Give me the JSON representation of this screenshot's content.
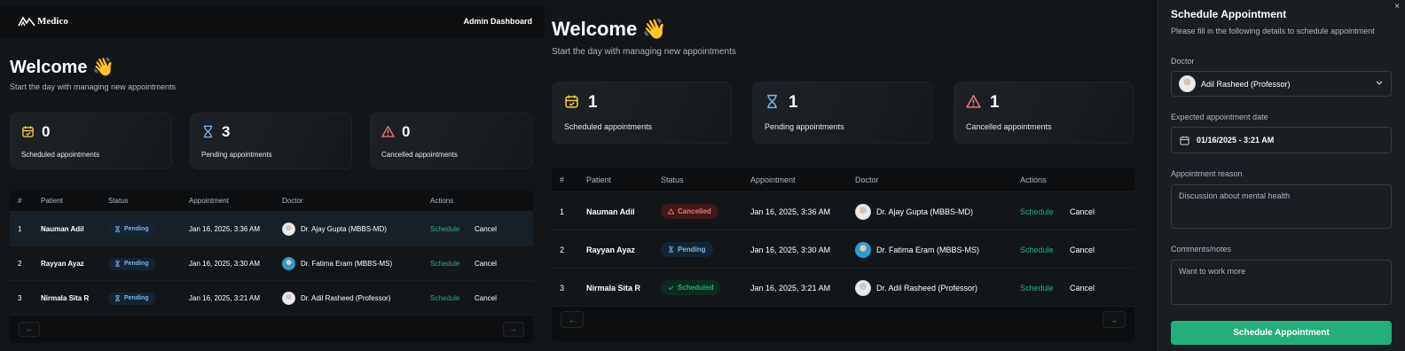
{
  "header": {
    "logo_text": "Medico",
    "title": "Admin Dashboard"
  },
  "welcome": {
    "title": "Welcome",
    "emoji": "👋",
    "subtitle": "Start the day with managing new appointments"
  },
  "icons": {
    "scheduled": "calendar-icon",
    "pending": "hourglass-icon",
    "cancelled": "warning-triangle-icon",
    "next": "arrow-right-icon",
    "prev": "arrow-left-icon",
    "close": "close-icon",
    "dropdown": "chevron-down-icon",
    "date": "calendar-icon"
  },
  "colors": {
    "green": "#24ae7c",
    "yellow": "#ffd147",
    "blue": "#79b5ec",
    "red": "#f37877"
  },
  "columns": [
    "#",
    "Patient",
    "Status",
    "Appointment",
    "Doctor",
    "Actions"
  ],
  "actions": {
    "schedule": "Schedule",
    "cancel": "Cancel"
  },
  "pager": {
    "prev": "←",
    "next": "→"
  },
  "view1": {
    "stats": [
      {
        "count": "0",
        "label": "Scheduled appointments"
      },
      {
        "count": "3",
        "label": "Pending appointments"
      },
      {
        "count": "0",
        "label": "Cancelled appointments"
      }
    ],
    "rows": [
      {
        "num": "1",
        "patient": "Nauman Adil",
        "status": "Pending",
        "date": "Jan 16, 2025, 3:36 AM",
        "doctor": "Dr. Ajay Gupta (MBBS-MD)"
      },
      {
        "num": "2",
        "patient": "Rayyan Ayaz",
        "status": "Pending",
        "date": "Jan 16, 2025, 3:30 AM",
        "doctor": "Dr. Fatima Eram (MBBS-MS)"
      },
      {
        "num": "3",
        "patient": "Nirmala Sita R",
        "status": "Pending",
        "date": "Jan 16, 2025, 3:21 AM",
        "doctor": "Dr. Adil Rasheed (Professor)"
      }
    ]
  },
  "view2": {
    "stats": [
      {
        "count": "1",
        "label": "Scheduled appointments"
      },
      {
        "count": "1",
        "label": "Pending appointments"
      },
      {
        "count": "1",
        "label": "Cancelled appointments"
      }
    ],
    "rows": [
      {
        "num": "1",
        "patient": "Nauman Adil",
        "status": "Cancelled",
        "date": "Jan 16, 2025, 3:36 AM",
        "doctor": "Dr. Ajay Gupta (MBBS-MD)"
      },
      {
        "num": "2",
        "patient": "Rayyan Ayaz",
        "status": "Pending",
        "date": "Jan 16, 2025, 3:30 AM",
        "doctor": "Dr. Fatima Eram (MBBS-MS)"
      },
      {
        "num": "3",
        "patient": "Nirmala Sita R",
        "status": "Scheduled",
        "date": "Jan 16, 2025, 3:21 AM",
        "doctor": "Dr. Adil Rasheed (Professor)"
      }
    ]
  },
  "form": {
    "close": "×",
    "title": "Schedule Appointment",
    "subtitle": "Please fill in the following details to schedule appointment",
    "doctor_label": "Doctor",
    "doctor_value": "Adil Rasheed (Professor)",
    "date_label": "Expected appointment date",
    "date_value": "01/16/2025 - 3:21 AM",
    "reason_label": "Appointment reason",
    "reason_value": "Discussion about mental health",
    "notes_label": "Comments/notes",
    "notes_value": "Want to work more",
    "submit": "Schedule Appointment"
  }
}
